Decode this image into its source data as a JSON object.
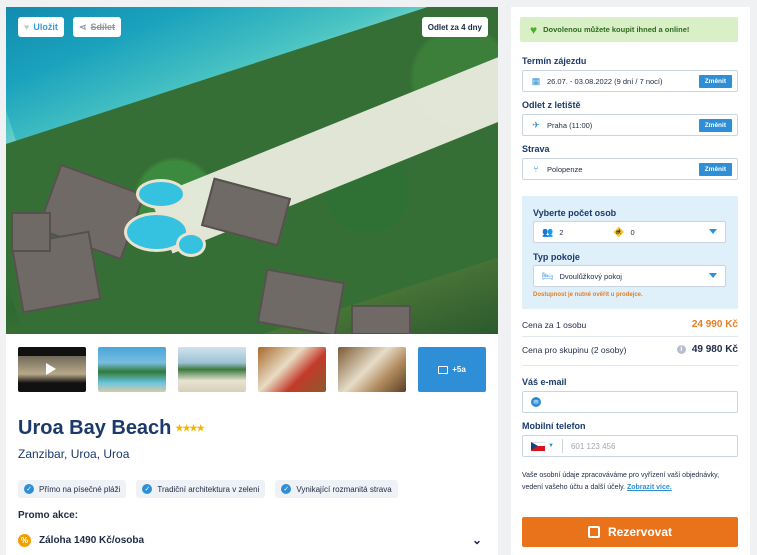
{
  "gallery": {
    "save_label": "Uložit",
    "share_label": "Sdílet",
    "departure_tag": "Odlet za 4 dny",
    "more_label": "+5a"
  },
  "hotel": {
    "name": "Uroa Bay Beach",
    "stars": "★★★★",
    "location": "Zanzibar, Uroa, Uroa",
    "features": [
      "Přímo na písečné pláži",
      "Tradiční architektura v zeleni",
      "Vynikající rozmanitá strava"
    ]
  },
  "promo": {
    "label": "Promo akce:",
    "item": "Záloha 1490 Kč/osoba"
  },
  "booking": {
    "notice": "Dovolenou můžete koupit ihned a online!",
    "date_label": "Termín zájezdu",
    "date_value": "26.07. - 03.08.2022 (9 dní / 7 nocí)",
    "departure_label": "Odlet z letiště",
    "departure_value": "Praha (11:00)",
    "board_label": "Strava",
    "board_value": "Polopenze",
    "change_label": "Změnit",
    "persons_label": "Vyberte počet osob",
    "adults": "2",
    "children": "0",
    "room_label": "Typ pokoje",
    "room_value": "Dvoulůžkový pokoj",
    "availability": "Dostupnost je nutné ověřit u prodejce.",
    "price_one_label": "Cena za 1 osobu",
    "price_one_value": "24 990 Kč",
    "price_group_label": "Cena pro skupinu (2 osoby)",
    "price_group_value": "49 980 Kč",
    "email_label": "Váš e-mail",
    "phone_label": "Mobilní telefon",
    "phone_placeholder": "601 123 456",
    "gdpr_text": "Vaše osobní údaje zpracováváme pro vyřízení vaší objednávky, vedení vašeho účtu a další účely.",
    "gdpr_link": "Zobrazit více.",
    "cta_label": "Rezervovat"
  },
  "colors": {
    "accent": "#2f8fd6",
    "cta": "#e8731a",
    "price": "#e67e22",
    "notice_bg": "#d9f0c7"
  }
}
